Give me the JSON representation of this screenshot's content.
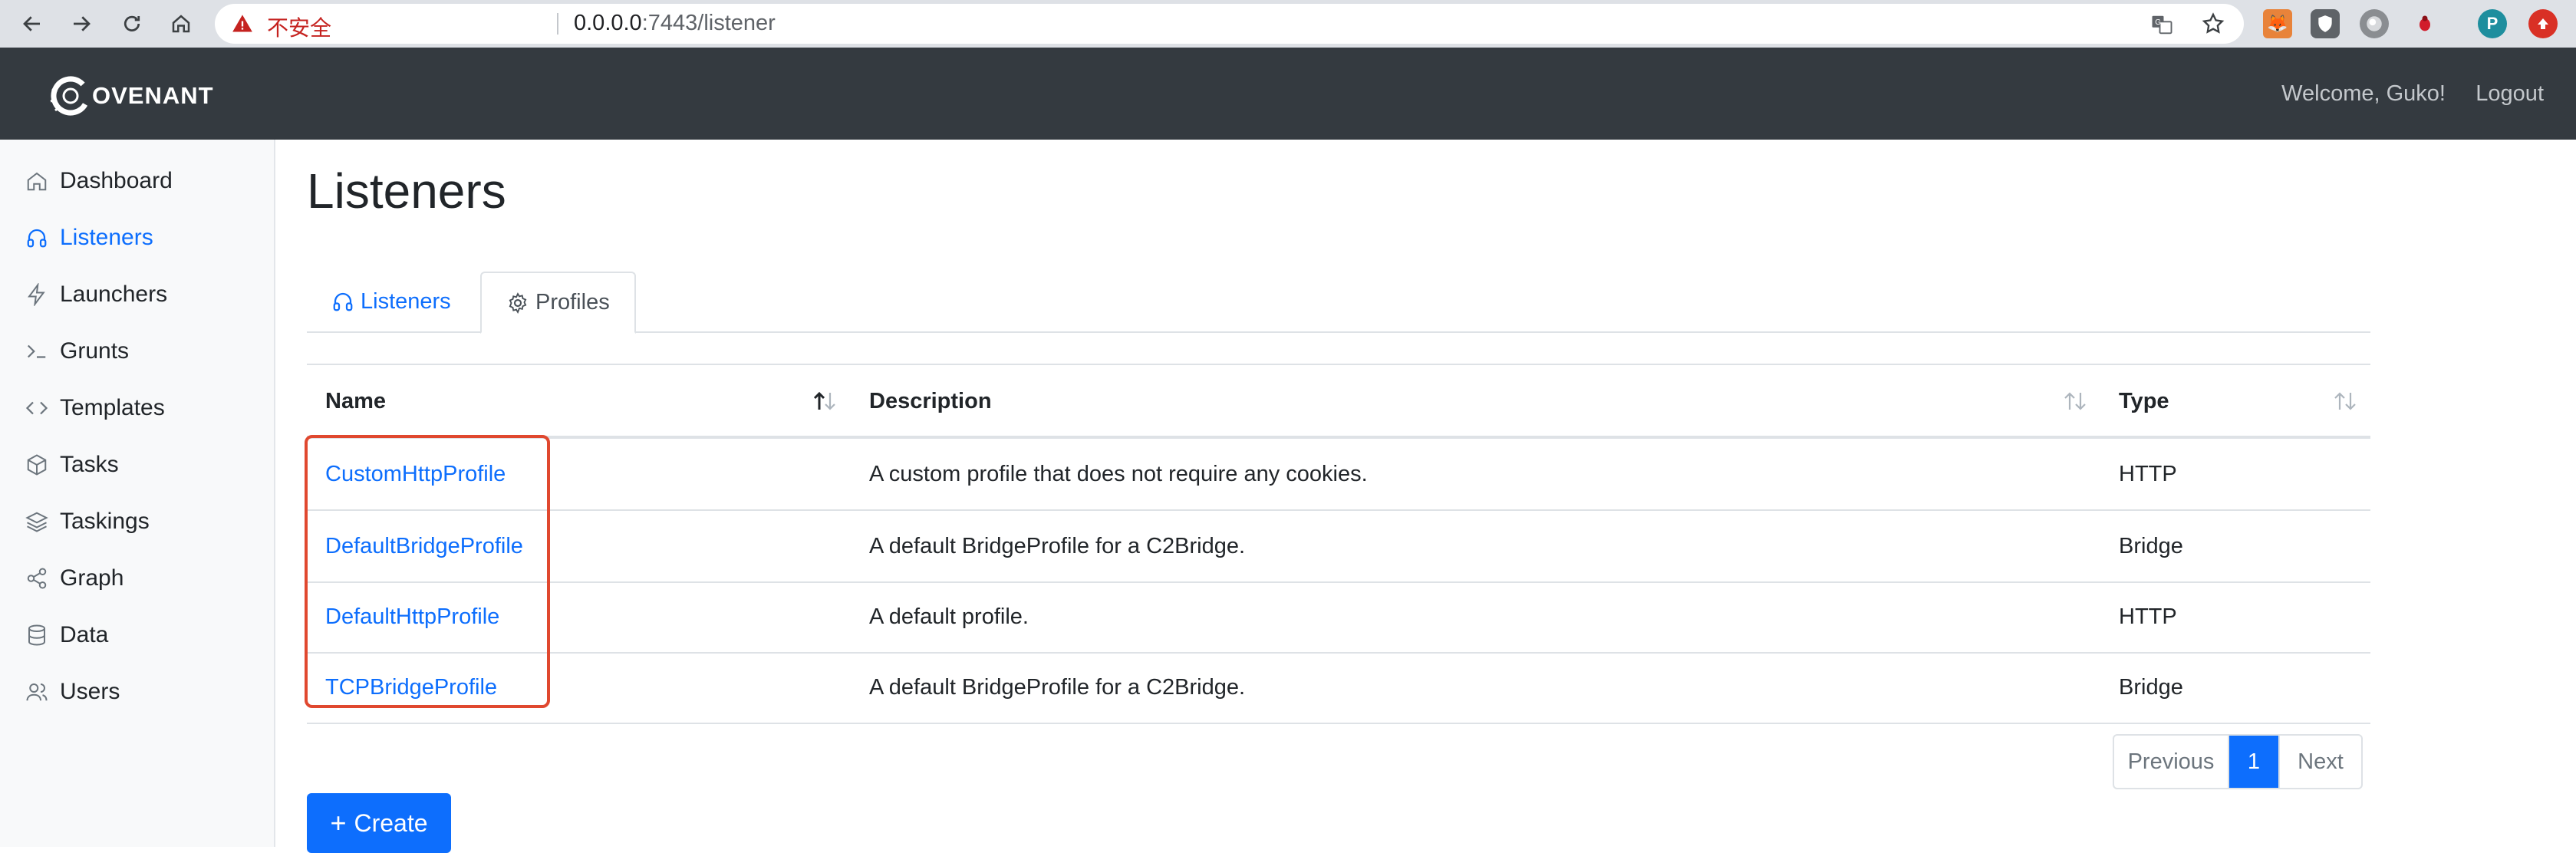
{
  "browser": {
    "insecure_label": "不安全",
    "url_host": "0.0.0.0",
    "url_path": ":7443/listener",
    "profile_initial": "P"
  },
  "header": {
    "brand": "OVENANT",
    "welcome": "Welcome, Guko!",
    "logout": "Logout"
  },
  "sidebar": {
    "items": [
      {
        "label": "Dashboard",
        "icon": "home-icon"
      },
      {
        "label": "Listeners",
        "icon": "headphones-icon",
        "active": true
      },
      {
        "label": "Launchers",
        "icon": "lightning-icon"
      },
      {
        "label": "Grunts",
        "icon": "terminal-icon"
      },
      {
        "label": "Templates",
        "icon": "code-icon"
      },
      {
        "label": "Tasks",
        "icon": "box-icon"
      },
      {
        "label": "Taskings",
        "icon": "layers-icon"
      },
      {
        "label": "Graph",
        "icon": "share-icon"
      },
      {
        "label": "Data",
        "icon": "database-icon"
      },
      {
        "label": "Users",
        "icon": "users-icon"
      }
    ]
  },
  "page": {
    "title": "Listeners",
    "tabs": [
      {
        "label": "Listeners",
        "icon": "headphones-icon"
      },
      {
        "label": "Profiles",
        "icon": "gear-icon",
        "active": true
      }
    ]
  },
  "table": {
    "columns": [
      "Name",
      "Description",
      "Type"
    ],
    "rows": [
      {
        "name": "CustomHttpProfile",
        "description": "A custom profile that does not require any cookies.",
        "type": "HTTP"
      },
      {
        "name": "DefaultBridgeProfile",
        "description": "A default BridgeProfile for a C2Bridge.",
        "type": "Bridge"
      },
      {
        "name": "DefaultHttpProfile",
        "description": "A default profile.",
        "type": "HTTP"
      },
      {
        "name": "TCPBridgeProfile",
        "description": "A default BridgeProfile for a C2Bridge.",
        "type": "Bridge"
      }
    ]
  },
  "pagination": {
    "previous": "Previous",
    "current": "1",
    "next": "Next"
  },
  "actions": {
    "create": "Create"
  },
  "colors": {
    "accent": "#0d6efd",
    "header_bg": "#343a40",
    "highlight": "#e0482f"
  }
}
